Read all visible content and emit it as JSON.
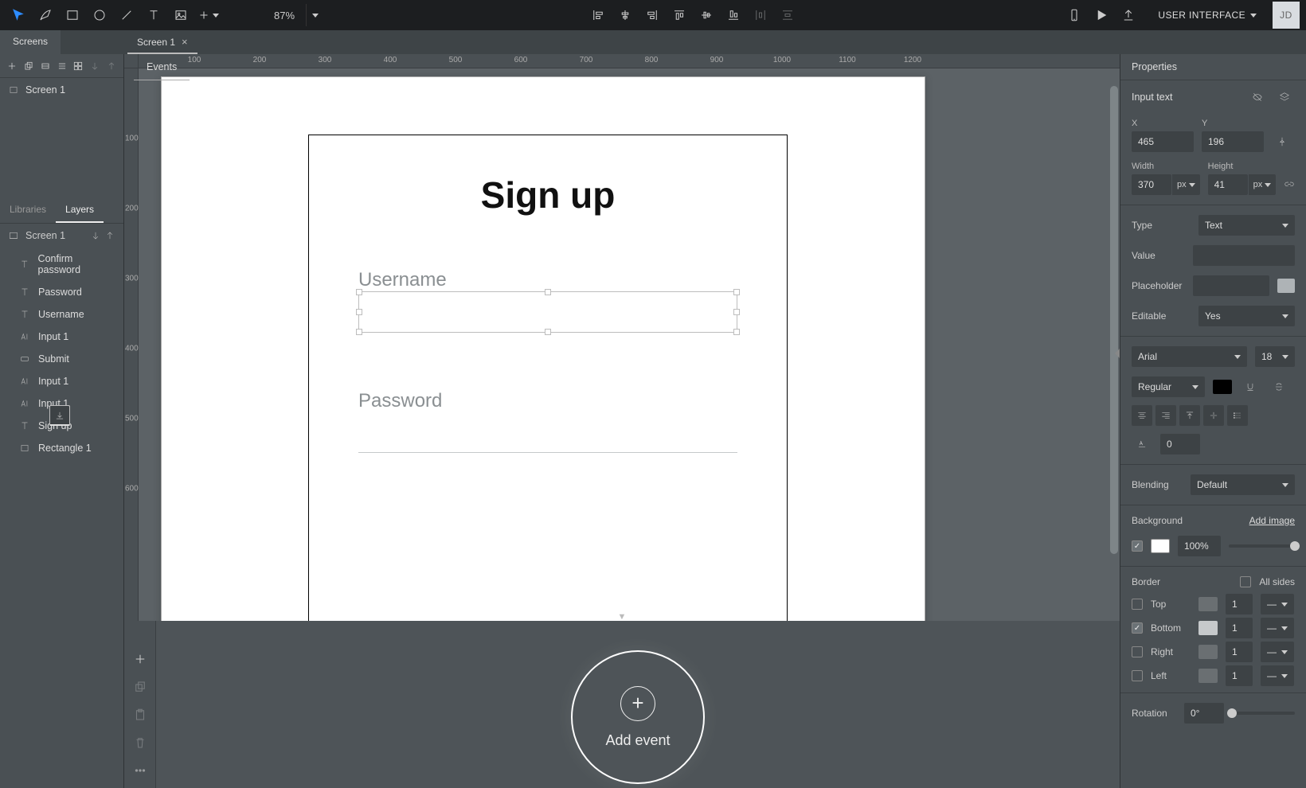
{
  "topbar": {
    "zoom": "87%",
    "mode_label": "USER INTERFACE",
    "avatar": "JD"
  },
  "screens_tab": "Screens",
  "canvas_tab": {
    "label": "Screen 1"
  },
  "screens": {
    "item": "Screen 1"
  },
  "lib_tab": "Libraries",
  "layers_tab": "Layers",
  "layer_head": "Screen 1",
  "layers": [
    {
      "icon": "T",
      "label": "Confirm password"
    },
    {
      "icon": "T",
      "label": "Password"
    },
    {
      "icon": "T",
      "label": "Username"
    },
    {
      "icon": "AI",
      "label": "Input 1"
    },
    {
      "icon": "btn",
      "label": "Submit"
    },
    {
      "icon": "AI",
      "label": "Input 1"
    },
    {
      "icon": "AI",
      "label": "Input 1"
    },
    {
      "icon": "T",
      "label": "Sign up"
    },
    {
      "icon": "rect",
      "label": "Rectangle 1"
    }
  ],
  "artboard": {
    "heading": "Sign up",
    "username_label": "Username",
    "password_label": "Password"
  },
  "ruler_h": [
    "100",
    "200",
    "300",
    "400",
    "500",
    "600",
    "700",
    "800",
    "900",
    "1000",
    "1100",
    "1200"
  ],
  "ruler_v": [
    "100",
    "200",
    "300",
    "400",
    "500",
    "600"
  ],
  "events": {
    "tab": "Events",
    "add": "Add event"
  },
  "properties": {
    "tab": "Properties",
    "element": "Input text",
    "x_label": "X",
    "x": "465",
    "y_label": "Y",
    "y": "196",
    "w_label": "Width",
    "w": "370",
    "w_unit": "px",
    "h_label": "Height",
    "h": "41",
    "h_unit": "px",
    "type_label": "Type",
    "type": "Text",
    "value_label": "Value",
    "value": "",
    "placeholder_label": "Placeholder",
    "placeholder": "",
    "editable_label": "Editable",
    "editable": "Yes",
    "font": "Arial",
    "font_size": "18",
    "weight": "Regular",
    "letterspacing_label": "0",
    "blending_label": "Blending",
    "blending": "Default",
    "background_label": "Background",
    "add_image": "Add image",
    "bg_opacity": "100%",
    "border_label": "Border",
    "all_sides": "All sides",
    "top": "Top",
    "bottom": "Bottom",
    "right": "Right",
    "left": "Left",
    "bw_top": "1",
    "bw_bottom": "1",
    "bw_right": "1",
    "bw_left": "1",
    "rotation_label": "Rotation",
    "rotation": "0°"
  }
}
